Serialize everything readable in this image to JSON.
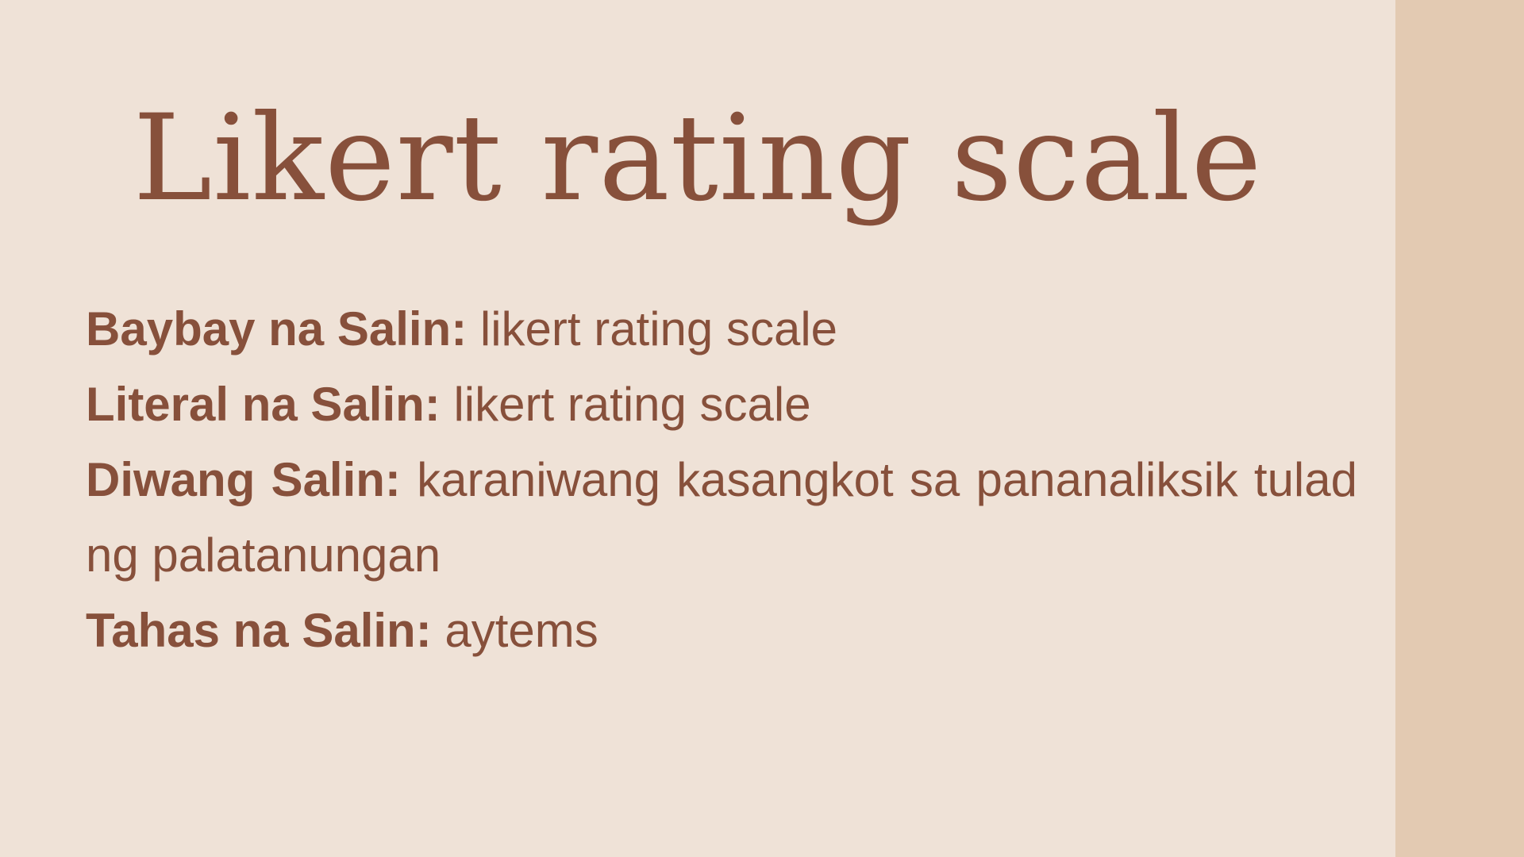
{
  "slide": {
    "title": "Likert rating scale",
    "entries": [
      {
        "label": "Baybay na Salin:",
        "value": "likert rating scale"
      },
      {
        "label": "Literal na Salin:",
        "value": "likert rating scale"
      },
      {
        "label": "Diwang Salin:",
        "value": "karaniwang kasangkot sa pananaliksik tulad ng palatanungan"
      },
      {
        "label": "Tahas na Salin:",
        "value": "aytems"
      }
    ]
  },
  "colors": {
    "background": "#efe2d7",
    "side_band": "#e3cab2",
    "text": "#87503b"
  }
}
